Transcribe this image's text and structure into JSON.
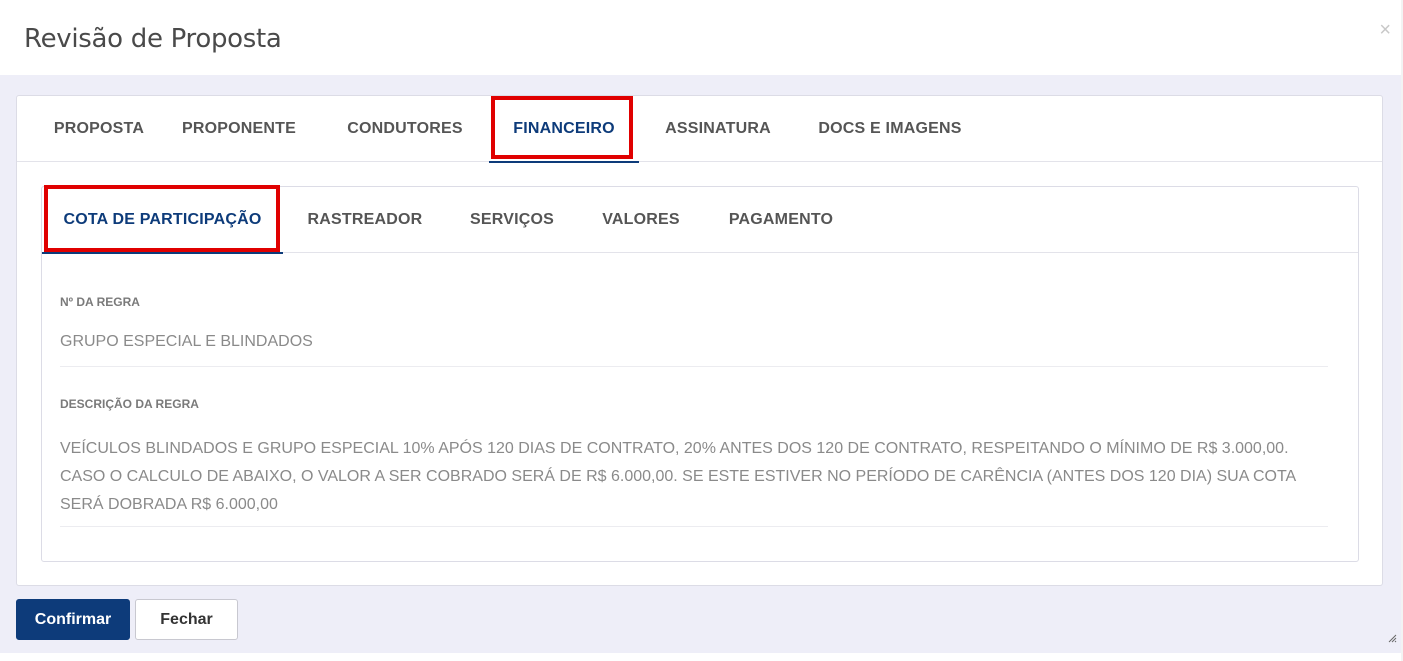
{
  "modal": {
    "title": "Revisão de Proposta",
    "close_symbol": "×"
  },
  "main_tabs": [
    {
      "label": "PROPOSTA",
      "active": false
    },
    {
      "label": "PROPONENTE",
      "active": false
    },
    {
      "label": "CONDUTORES",
      "active": false
    },
    {
      "label": "FINANCEIRO",
      "active": true
    },
    {
      "label": "ASSINATURA",
      "active": false
    },
    {
      "label": "DOCS E IMAGENS",
      "active": false
    }
  ],
  "sub_tabs": [
    {
      "label": "COTA DE PARTICIPAÇÃO",
      "active": true
    },
    {
      "label": "RASTREADOR",
      "active": false
    },
    {
      "label": "SERVIÇOS",
      "active": false
    },
    {
      "label": "VALORES",
      "active": false
    },
    {
      "label": "PAGAMENTO",
      "active": false
    }
  ],
  "fields": {
    "rule_number_label": "Nº DA REGRA",
    "rule_number_value": "GRUPO ESPECIAL E BLINDADOS",
    "rule_description_label": "DESCRIÇÃO DA REGRA",
    "rule_description_value": "VEÍCULOS BLINDADOS E GRUPO ESPECIAL 10% APÓS 120 DIAS DE CONTRATO, 20% ANTES DOS 120 DE CONTRATO, RESPEITANDO O MÍNIMO DE R$ 3.000,00. CASO O CALCULO DE ABAIXO, O VALOR A SER COBRADO SERÁ DE R$ 6.000,00. SE ESTE ESTIVER NO PERÍODO DE CARÊNCIA (ANTES DOS 120 DIA) SUA COTA SERÁ DOBRADA R$ 6.000,00"
  },
  "buttons": {
    "confirm_label": "Confirmar",
    "close_label": "Fechar"
  },
  "colors": {
    "accent": "#0d3b7a",
    "highlight": "#e00000",
    "backdrop": "#eeeef8"
  }
}
